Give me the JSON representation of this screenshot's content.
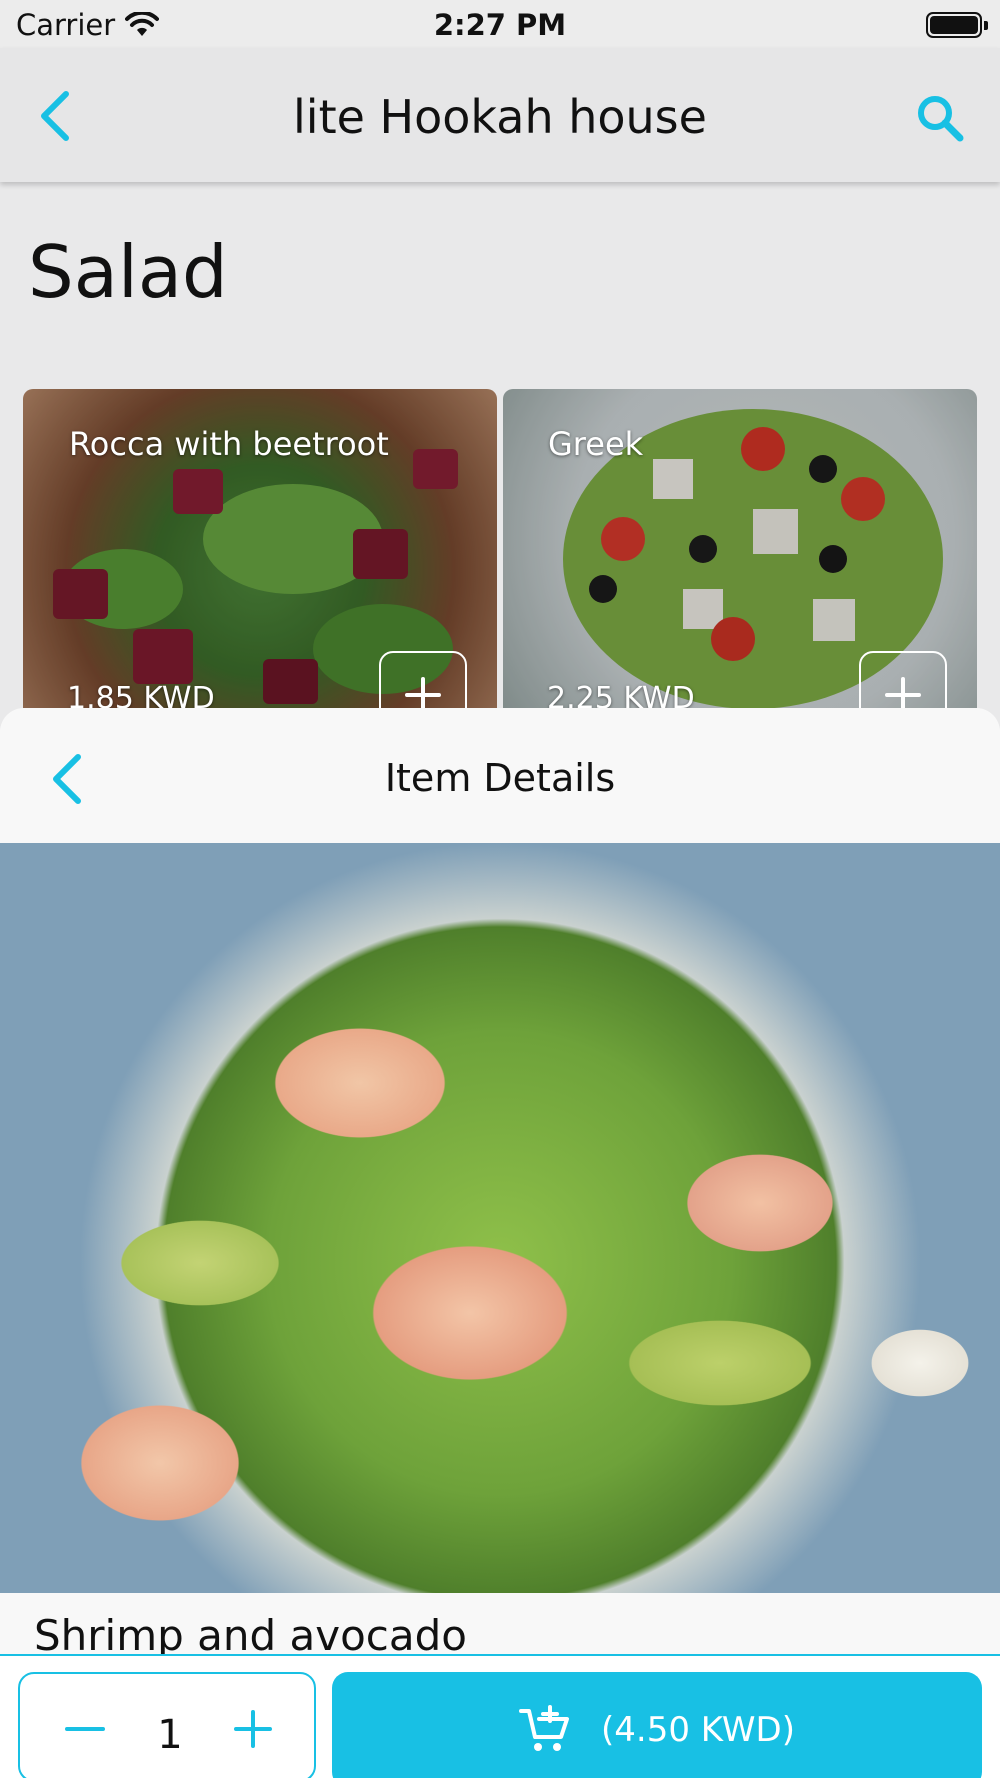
{
  "status_bar": {
    "carrier": "Carrier",
    "time": "2:27 PM"
  },
  "nav": {
    "title": "lite Hookah house"
  },
  "section": {
    "title": "Salad"
  },
  "cards": [
    {
      "name": "Rocca with beetroot",
      "price": "1.85 KWD"
    },
    {
      "name": "Greek",
      "price": "2.25 KWD"
    }
  ],
  "sheet": {
    "title": "Item Details",
    "item_name": "Shrimp and avocado",
    "quantity": "1",
    "add_to_cart_label": "(4.50 KWD)"
  },
  "colors": {
    "accent": "#18c0e4",
    "background": "#e9e9ea",
    "sheet": "#f8f8f8"
  },
  "icons": {
    "wifi": "wifi-icon",
    "battery": "battery-icon",
    "back": "chevron-left-icon",
    "search": "search-icon",
    "add": "plus-icon",
    "minus": "minus-icon",
    "cart": "cart-add-icon"
  }
}
